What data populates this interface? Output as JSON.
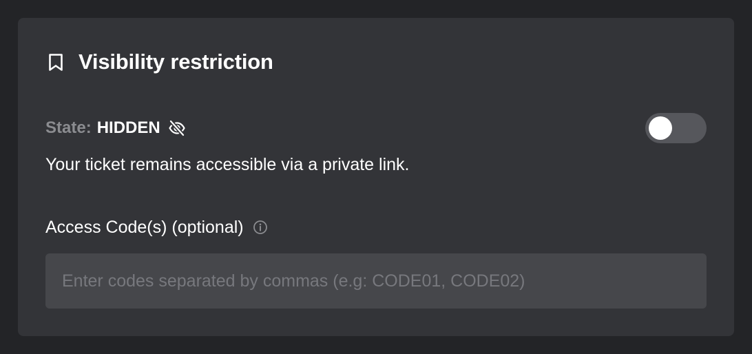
{
  "visibility": {
    "title": "Visibility restriction",
    "title_icon": "bookmark-icon",
    "state_label": "State:",
    "state_value": "HIDDEN",
    "state_icon": "eye-off-icon",
    "toggle_on": false,
    "description": "Your ticket remains accessible via a private link."
  },
  "access_codes": {
    "label": "Access Code(s) (optional)",
    "info_icon": "info-icon",
    "value": "",
    "placeholder": "Enter codes separated by commas (e.g: CODE01, CODE02)"
  },
  "colors": {
    "page_background": "#232427",
    "card_background": "#333438",
    "input_background": "#46474b",
    "toggle_track": "#56575c",
    "muted_text": "#8b8c90"
  }
}
